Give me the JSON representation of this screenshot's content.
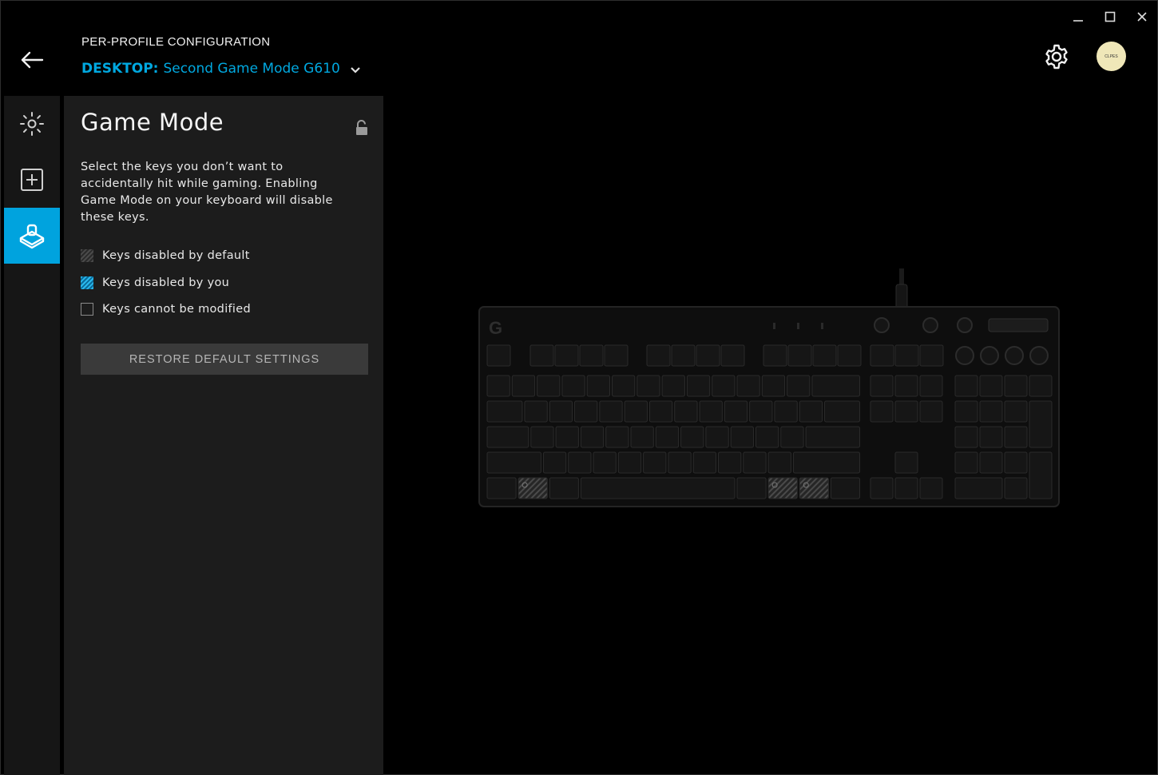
{
  "window": {
    "minimize": "—",
    "maximize": "☐",
    "close": "✕"
  },
  "header": {
    "section_label": "PER-PROFILE CONFIGURATION",
    "profile_prefix": "DESKTOP:",
    "profile_name": "Second Game Mode G610",
    "avatar_text": "CLPES"
  },
  "rail": {
    "items": [
      {
        "icon": "lighting-icon",
        "active": false
      },
      {
        "icon": "assignments-plus-icon",
        "active": false
      },
      {
        "icon": "game-mode-joystick-icon",
        "active": true
      }
    ]
  },
  "panel": {
    "title": "Game Mode",
    "description": "Select the keys you don’t want to accidentally hit while gaming. Enabling Game Mode on your keyboard will disable these keys.",
    "legend": [
      {
        "label": "Keys disabled by default",
        "swatch": "default"
      },
      {
        "label": "Keys disabled by you",
        "swatch": "you"
      },
      {
        "label": "Keys cannot be modified",
        "swatch": "none"
      }
    ],
    "restore_label": "RESTORE DEFAULT SETTINGS"
  },
  "keyboard": {
    "model": "G610",
    "disabled_by_default_keys": [
      "Left Windows",
      "Right Windows",
      "Menu"
    ],
    "colors": {
      "accent": "#00a3de",
      "disabled_default": "#4a4a4a"
    }
  }
}
